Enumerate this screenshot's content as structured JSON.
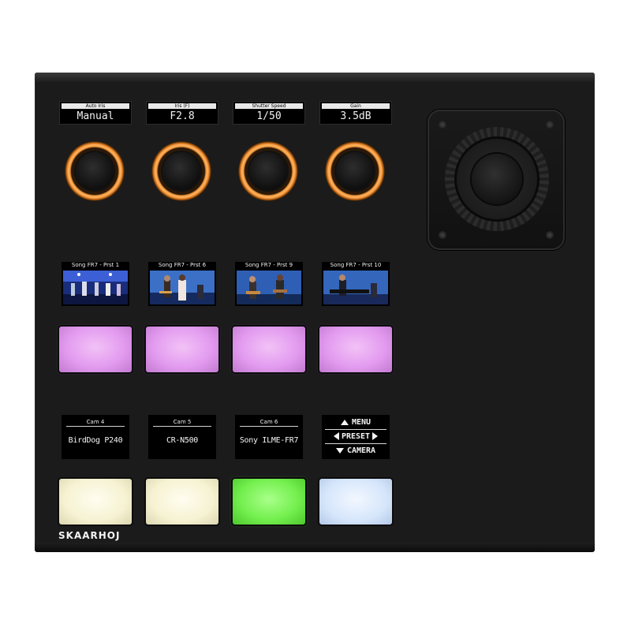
{
  "brand": "SKAARHOJ",
  "label_displays": [
    {
      "head": "Auto Iris",
      "value": "Manual"
    },
    {
      "head": "Iris (F)",
      "value": "F2.8"
    },
    {
      "head": "Shutter Speed",
      "value": "1/50"
    },
    {
      "head": "Gain",
      "value": "3.5dB"
    }
  ],
  "preview_displays": [
    {
      "head": "Song FR7 - Prst 1"
    },
    {
      "head": "Song FR7 - Prst 6"
    },
    {
      "head": "Song FR7 - Prst 9"
    },
    {
      "head": "Song FR7 - Prst 10"
    }
  ],
  "cam_displays": [
    {
      "head": "Cam 4",
      "value": "BirdDog P240"
    },
    {
      "head": "Cam 5",
      "value": "CR-N500"
    },
    {
      "head": "Cam 6",
      "value": "Sony ILME-FR7"
    }
  ],
  "menu_display": {
    "row1": "MENU",
    "row2": "PRESET",
    "row3": "CAMERA"
  },
  "button_colors": {
    "magenta": "#e39cf0",
    "cream": "#f6f2d2",
    "green": "#75f050",
    "light_blue": "#d6e6fb",
    "knob_ring": "#f39a3c"
  },
  "button_row_bottom_states": [
    "cream",
    "cream",
    "green",
    "light_blue"
  ]
}
